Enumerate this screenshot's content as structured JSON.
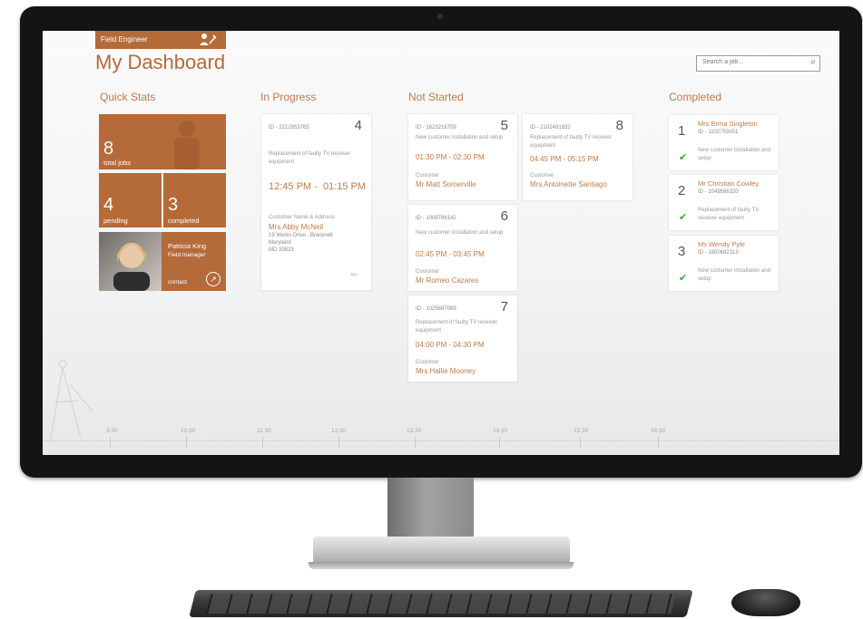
{
  "app": {
    "role": "Field Engineer",
    "title": "My Dashboard",
    "accent_color": "#b56a3a",
    "role_icon": "user-tools-icon"
  },
  "search": {
    "placeholder": "Search a job...",
    "icon": "search-icon"
  },
  "quick_stats": {
    "title": "Quick Stats",
    "total": {
      "value": "8",
      "label": "total jobs"
    },
    "pending": {
      "value": "4",
      "label": "pending"
    },
    "completed": {
      "value": "3",
      "label": "completed"
    },
    "manager": {
      "name": "Patricia King",
      "role": "Field manager",
      "contact_label": "contact"
    }
  },
  "in_progress": {
    "title": "In Progress",
    "card": {
      "number": "4",
      "id": "ID  -  2212953765",
      "description": "Replacement of faulty TV receiver equipment",
      "start": "12:45 PM",
      "end": "01:15 PM",
      "customer_label": "Customer Name & Address",
      "customer_name": "Mrs Abby McNeil",
      "address_line1": "19  Works Drive ,  Bracknell",
      "address_line2": "Maryland",
      "address_line3": "MD 33823"
    }
  },
  "not_started": {
    "title": "Not Started",
    "cards": [
      {
        "number": "5",
        "id": "ID  -  1623218759",
        "description": "New customer installation and setup",
        "start": "01:30 PM",
        "end": "02:30 PM",
        "customer_label": "Customer",
        "customer_name": "Mr Matt Somerville"
      },
      {
        "number": "8",
        "id": "ID  -  2102481832",
        "description": "Replacement of faulty TV receiver equipment",
        "start": "04:45 PM",
        "end": "05:15 PM",
        "customer_label": "Customer",
        "customer_name": "Mrs Antoinette Santiago"
      },
      {
        "number": "6",
        "id": "ID  -  1009786142",
        "description": "New customer installation and setup",
        "start": "02:45 PM",
        "end": "03:45 PM",
        "customer_label": "Customer",
        "customer_name": "Mr Romeo Cazares"
      },
      {
        "number": "7",
        "id": "ID  -  1025687089",
        "description": "Replacement of faulty TV receiver equipment",
        "start": "04:00 PM",
        "end": "04:30 PM",
        "customer_label": "Customer",
        "customer_name": "Mrs Hallie Mooney"
      }
    ]
  },
  "completed": {
    "title": "Completed",
    "status_color": "#3aa534",
    "cards": [
      {
        "number": "1",
        "name": "Mrs Erma Singleton",
        "id": "ID  -  1102753351",
        "description": "New customer installation and setup"
      },
      {
        "number": "2",
        "name": "Mr Christian Cowley",
        "id": "ID  -  1049586320",
        "description": "Replacement of faulty TV receiver equipment"
      },
      {
        "number": "3",
        "name": "Ms Wendy Pyle",
        "id": "ID  -  1800682313",
        "description": "New customer installation and setup"
      }
    ]
  },
  "timeline": {
    "ticks": [
      "9.30",
      "10.30",
      "11.30",
      "12.30",
      "13.30",
      "14.30",
      "15.30",
      "16.30"
    ]
  }
}
